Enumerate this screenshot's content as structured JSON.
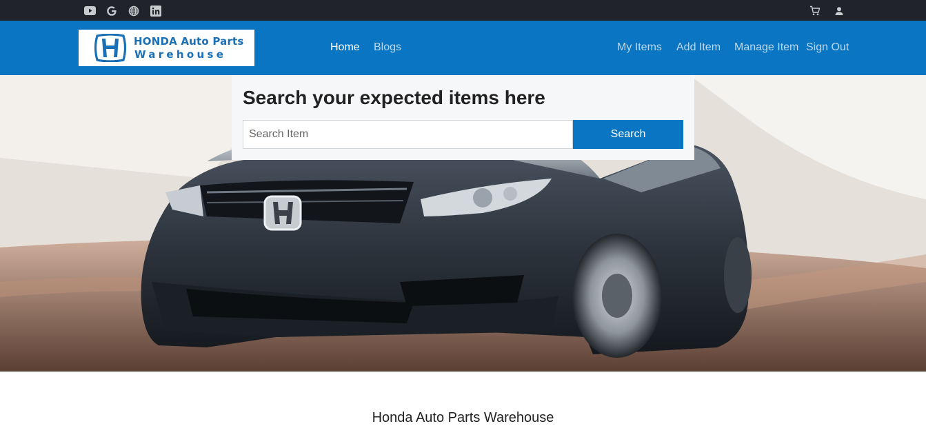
{
  "topbar": {
    "social_icons": [
      "youtube-icon",
      "google-icon",
      "globe-icon",
      "linkedin-icon"
    ],
    "right_icons": [
      "cart-icon",
      "user-icon"
    ]
  },
  "brand": {
    "line1": "HONDA Auto Parts",
    "line2": "Warehouse",
    "color": "#1a6fb5"
  },
  "nav": {
    "left": [
      {
        "label": "Home",
        "active": true
      },
      {
        "label": "Blogs",
        "active": false
      }
    ],
    "right": [
      {
        "label": "My Items"
      },
      {
        "label": "Add Item"
      },
      {
        "label": "Manage Item"
      },
      {
        "label": "Sign Out"
      }
    ]
  },
  "search": {
    "title": "Search your expected items here",
    "placeholder": "Search Item",
    "value": "",
    "button_label": "Search"
  },
  "footer": {
    "title": "Honda Auto Parts Warehouse"
  },
  "colors": {
    "topbar": "#202329",
    "navbar": "#0a75c2",
    "accent": "#0a75c2",
    "nav_inactive": "#bcd8ee",
    "nav_active": "#ffffff"
  }
}
